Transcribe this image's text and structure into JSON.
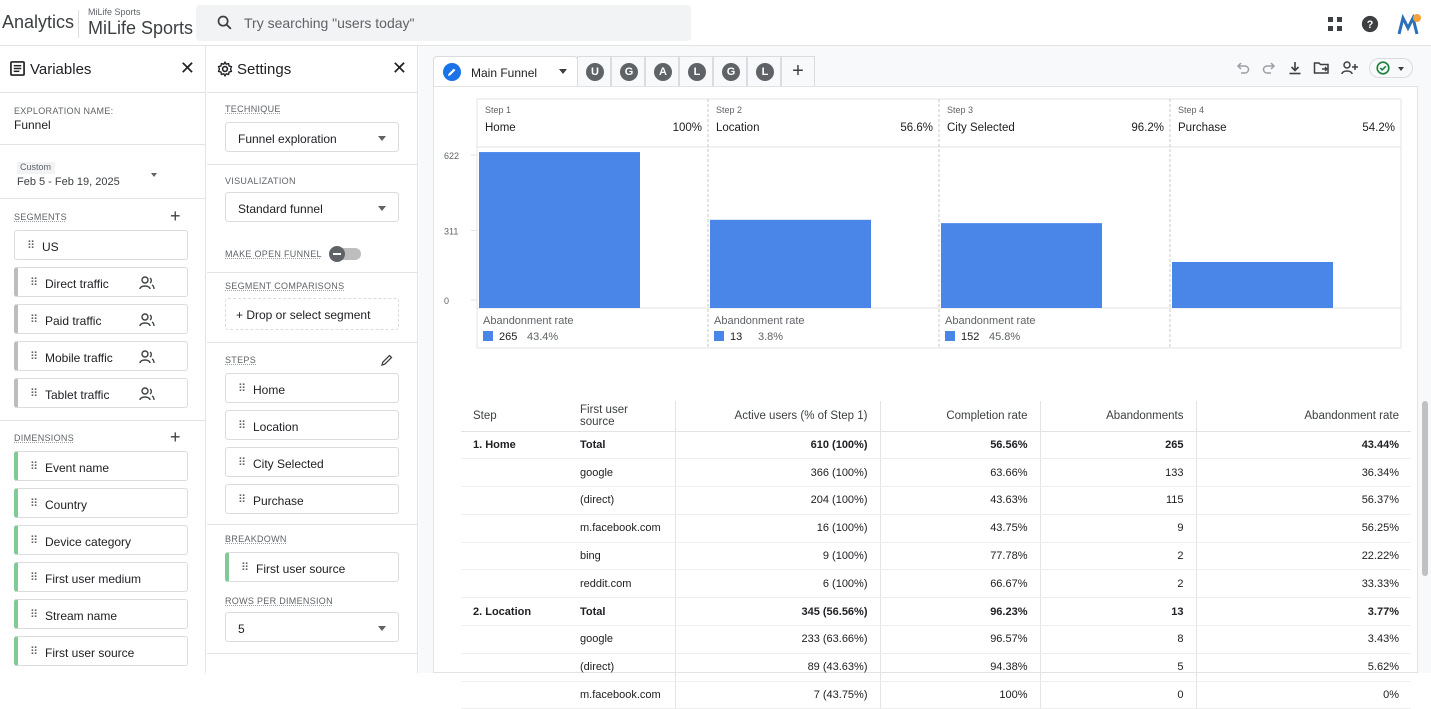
{
  "header": {
    "product": "Analytics",
    "property_small": "MiLife Sports",
    "property_big": "MiLife Sports",
    "search_placeholder": "Try searching \"users today\""
  },
  "variables": {
    "title": "Variables",
    "exploration_label": "EXPLORATION NAME:",
    "exploration_name": "Funnel",
    "date_label": "Custom",
    "date_range": "Feb 5 - Feb 19, 2025",
    "segments_label": "SEGMENTS",
    "segments": [
      "US",
      "Direct traffic",
      "Paid traffic",
      "Mobile traffic",
      "Tablet traffic"
    ],
    "dimensions_label": "DIMENSIONS",
    "dimensions": [
      "Event name",
      "Country",
      "Device category",
      "First user medium",
      "Stream name",
      "First user source"
    ]
  },
  "settings": {
    "title": "Settings",
    "technique_label": "TECHNIQUE",
    "technique": "Funnel exploration",
    "visualization_label": "VISUALIZATION",
    "visualization": "Standard funnel",
    "open_funnel_label": "MAKE OPEN FUNNEL",
    "segment_comparisons_label": "SEGMENT COMPARISONS",
    "drop_segment": "+ Drop or select segment",
    "steps_label": "STEPS",
    "steps": [
      "Home",
      "Location",
      "City Selected",
      "Purchase"
    ],
    "breakdown_label": "BREAKDOWN",
    "breakdown": "First user source",
    "rows_label": "ROWS PER DIMENSION",
    "rows": "5"
  },
  "tabs": {
    "main": "Main Funnel",
    "mini": [
      "U",
      "G",
      "A",
      "L",
      "G",
      "L"
    ],
    "add": "+"
  },
  "chart_data": {
    "type": "bar",
    "ylim": [
      0,
      622
    ],
    "yticks": [
      "622",
      "311",
      "0"
    ],
    "steps": [
      {
        "step": "Step 1",
        "name": "Home",
        "pct": "100%",
        "value": 610,
        "abandon_label": "Abandonment rate",
        "abandon_count": "265",
        "abandon_rate": "43.4%"
      },
      {
        "step": "Step 2",
        "name": "Location",
        "pct": "56.6%",
        "value": 345,
        "abandon_label": "Abandonment rate",
        "abandon_count": "13",
        "abandon_rate": "3.8%"
      },
      {
        "step": "Step 3",
        "name": "City Selected",
        "pct": "96.2%",
        "value": 332,
        "abandon_label": "Abandonment rate",
        "abandon_count": "152",
        "abandon_rate": "45.8%"
      },
      {
        "step": "Step 4",
        "name": "Purchase",
        "pct": "54.2%",
        "value": 180,
        "abandon_label": "",
        "abandon_count": "",
        "abandon_rate": ""
      }
    ],
    "bar_color": "#4a85e8"
  },
  "table": {
    "headers": [
      "Step",
      "First user source",
      "Active users (% of Step 1)",
      "Completion rate",
      "Abandonments",
      "Abandonment rate"
    ],
    "rows": [
      [
        "1. Home",
        "Total",
        "610 (100%)",
        "56.56%",
        "265",
        "43.44%"
      ],
      [
        "",
        "google",
        "366 (100%)",
        "63.66%",
        "133",
        "36.34%"
      ],
      [
        "",
        "(direct)",
        "204 (100%)",
        "43.63%",
        "115",
        "56.37%"
      ],
      [
        "",
        "m.facebook.com",
        "16 (100%)",
        "43.75%",
        "9",
        "56.25%"
      ],
      [
        "",
        "bing",
        "9 (100%)",
        "77.78%",
        "2",
        "22.22%"
      ],
      [
        "",
        "reddit.com",
        "6 (100%)",
        "66.67%",
        "2",
        "33.33%"
      ],
      [
        "2. Location",
        "Total",
        "345 (56.56%)",
        "96.23%",
        "13",
        "3.77%"
      ],
      [
        "",
        "google",
        "233 (63.66%)",
        "96.57%",
        "8",
        "3.43%"
      ],
      [
        "",
        "(direct)",
        "89 (43.63%)",
        "94.38%",
        "5",
        "5.62%"
      ],
      [
        "",
        "m.facebook.com",
        "7 (43.75%)",
        "100%",
        "0",
        "0%"
      ]
    ]
  }
}
